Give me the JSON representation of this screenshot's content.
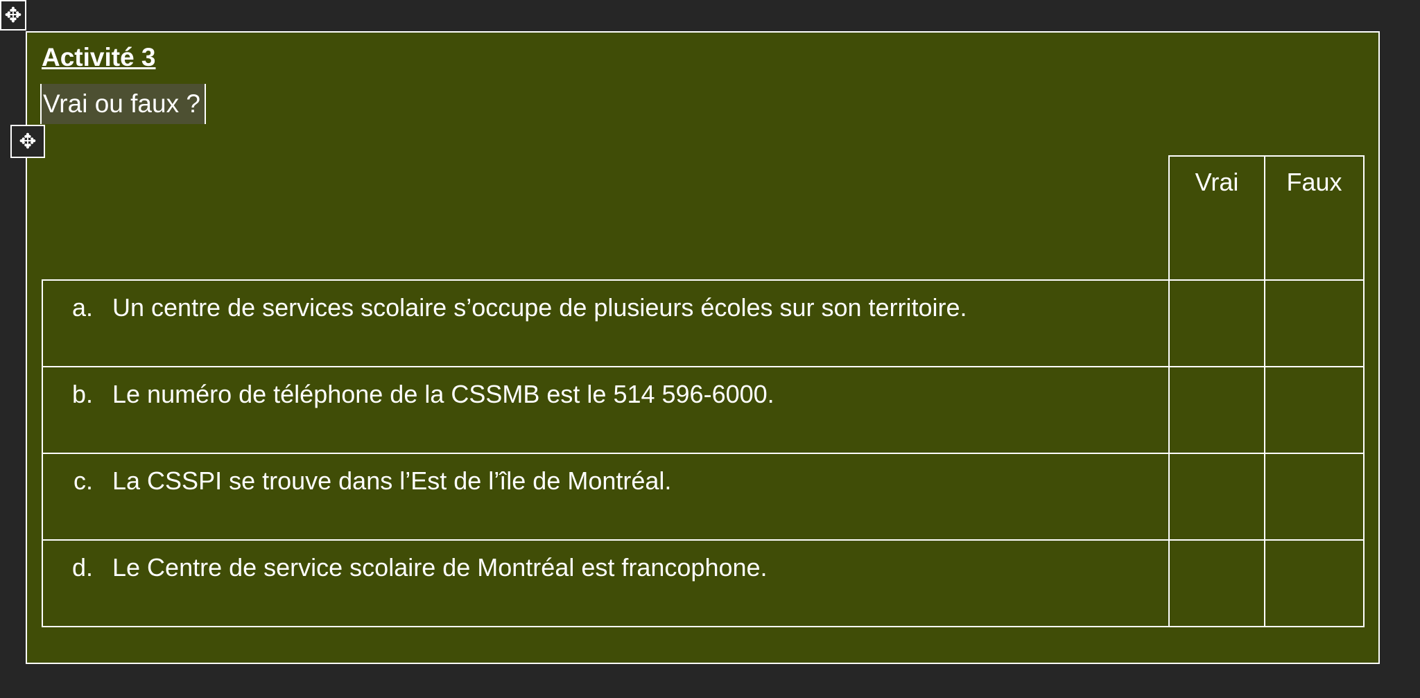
{
  "heading": "Activité 3",
  "subheading": "Vrai ou faux ?",
  "columns": {
    "true": "Vrai",
    "false": "Faux"
  },
  "statements": [
    {
      "letter": "a.",
      "text": "Un centre de services scolaire s’occupe de plusieurs écoles sur son territoire."
    },
    {
      "letter": "b.",
      "text": "Le numéro de téléphone de la CSSMB est le 514 596-6000."
    },
    {
      "letter": "c.",
      "text": "La CSSPI se trouve dans l’Est de l’île de Montréal."
    },
    {
      "letter": "d.",
      "text": "Le Centre de service scolaire de Montréal est francophone."
    }
  ],
  "icons": {
    "move": "move-handle-icon"
  }
}
